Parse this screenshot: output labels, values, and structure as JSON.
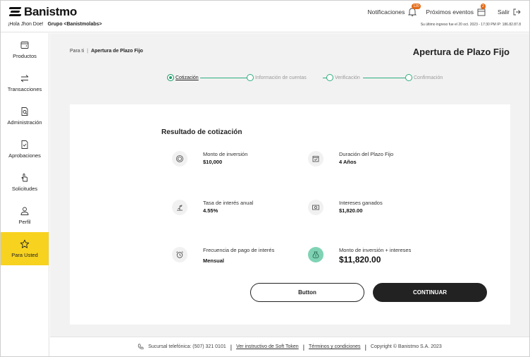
{
  "header": {
    "brand": "Banistmo",
    "greeting": "¡Hola Jhon Doe!",
    "group": "Grupo <Banistmolabs>",
    "notifications_label": "Notificaciones",
    "notifications_count": "120",
    "events_label": "Próximos eventos",
    "events_count": "2",
    "logout_label": "Salir",
    "last_login": "Su último ingreso fue el 20 oct. 2023 - 17:30 PM IP: 186.82.87.8"
  },
  "sidebar": {
    "items": [
      {
        "label": "Productos",
        "icon": "wallet-icon"
      },
      {
        "label": "Transacciones",
        "icon": "transfer-arrows-icon"
      },
      {
        "label": "Administración",
        "icon": "document-search-icon"
      },
      {
        "label": "Aprobaciones",
        "icon": "document-check-icon"
      },
      {
        "label": "Solicitudes",
        "icon": "hand-pointer-icon"
      },
      {
        "label": "Perfil",
        "icon": "user-icon"
      },
      {
        "label": "Para Usted",
        "icon": "star-icon",
        "active": true
      }
    ]
  },
  "breadcrumb": {
    "root": "Para ti",
    "separator": "|",
    "current": "Apertura de Plazo Fijo"
  },
  "page_title": "Apertura de Plazo Fijo",
  "stepper": {
    "steps": [
      {
        "label": "Cotización",
        "active": true
      },
      {
        "label": "Información de cuentas",
        "active": false
      },
      {
        "label": "Verificación",
        "active": false
      },
      {
        "label": "Confirmación",
        "active": false
      }
    ]
  },
  "card": {
    "title": "Resultado de cotización",
    "items": {
      "monto": {
        "label": "Monto de inversión",
        "value": "$10,000",
        "icon": "coin-icon"
      },
      "duracion": {
        "label": "Duración del Plazo Fijo",
        "value": "4 Años",
        "icon": "calendar-check-icon"
      },
      "tasa": {
        "label": "Tasa de interés anual",
        "value": "4.55%",
        "icon": "growth-plant-icon"
      },
      "intereses": {
        "label": "Intereses ganados",
        "value": "$1,820.00",
        "icon": "cash-icon"
      },
      "frecuencia": {
        "label": "Frecuencia de pago de interés",
        "value": "Mensual",
        "icon": "alarm-clock-icon"
      },
      "total": {
        "label": "Monto de inversión + intereses",
        "value": "$11,820.00",
        "icon": "money-bag-icon"
      }
    },
    "secondary_button": "Button",
    "primary_button": "CONTINUAR"
  },
  "footer": {
    "phone": "Sucursal telefónica: (507) 321 0101",
    "soft_token": "Ver instructivo de Soft Token",
    "terms": "Términos y condiciones",
    "copyright": "Copyright © Banistmo S.A. 2023"
  },
  "colors": {
    "accent_yellow": "#f7d21f",
    "step_green": "#1f9e6b",
    "badge_orange": "#e46a16",
    "button_dark": "#222222"
  }
}
